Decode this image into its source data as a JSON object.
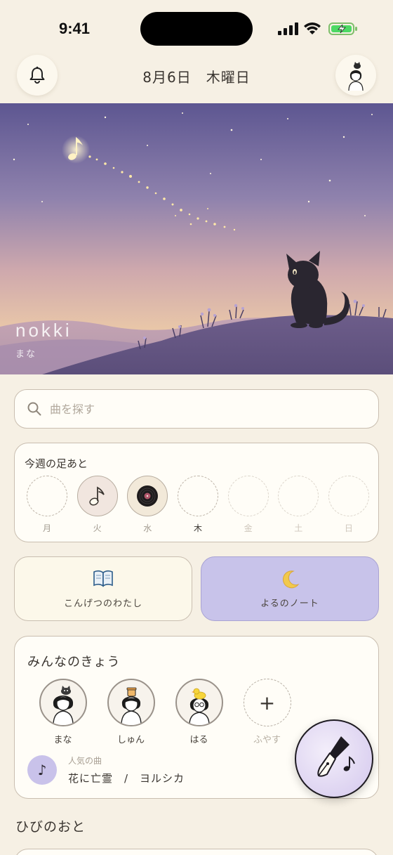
{
  "status_bar": {
    "time": "9:41"
  },
  "header": {
    "date": "8月6日　木曜日"
  },
  "hero": {
    "title": "nokki",
    "subtitle": "まな"
  },
  "search": {
    "placeholder": "曲を探す"
  },
  "week": {
    "title": "今週の足あと",
    "days": [
      {
        "label": "月",
        "state": "empty"
      },
      {
        "label": "火",
        "state": "note"
      },
      {
        "label": "水",
        "state": "record"
      },
      {
        "label": "木",
        "state": "today"
      },
      {
        "label": "金",
        "state": "future"
      },
      {
        "label": "土",
        "state": "future"
      },
      {
        "label": "日",
        "state": "future"
      }
    ]
  },
  "modes": {
    "day": {
      "icon": "book-icon",
      "label": "こんげつのわたし"
    },
    "night": {
      "icon": "crescent-moon-icon",
      "label": "よるのノート"
    }
  },
  "friends": {
    "title": "みんなのきょう",
    "people": [
      {
        "name": "まな"
      },
      {
        "name": "しゅん"
      },
      {
        "name": "はる"
      }
    ],
    "add_label": "ふやす",
    "popular_caption": "人気の曲",
    "popular_song": "花に亡霊　/　ヨルシカ"
  },
  "section": {
    "title": "ひびのおと"
  },
  "colors": {
    "background": "#f6f0e4",
    "night_button": "#c8c3ea",
    "accent_purple": "#c9c2ea"
  }
}
